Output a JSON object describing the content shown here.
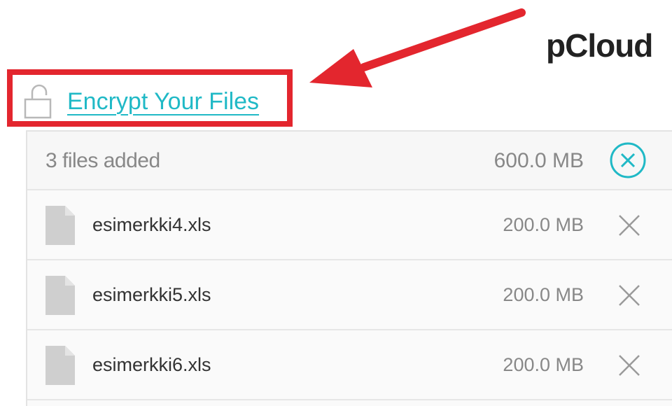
{
  "brand": {
    "name": "pCloud"
  },
  "encrypt": {
    "label": "Encrypt Your Files"
  },
  "summary": {
    "count_label": "3 files added",
    "total_size": "600.0 MB"
  },
  "files": [
    {
      "name": "esimerkki4.xls",
      "size": "200.0 MB"
    },
    {
      "name": "esimerkki5.xls",
      "size": "200.0 MB"
    },
    {
      "name": "esimerkki6.xls",
      "size": "200.0 MB"
    }
  ],
  "colors": {
    "accent": "#20b9c6",
    "highlight": "#e3262e",
    "icon_gray": "#cfcfcf"
  },
  "icons": {
    "lock": "unlocked-padlock-icon",
    "file": "file-icon",
    "remove": "close-icon",
    "remove_all": "close-circle-icon"
  }
}
